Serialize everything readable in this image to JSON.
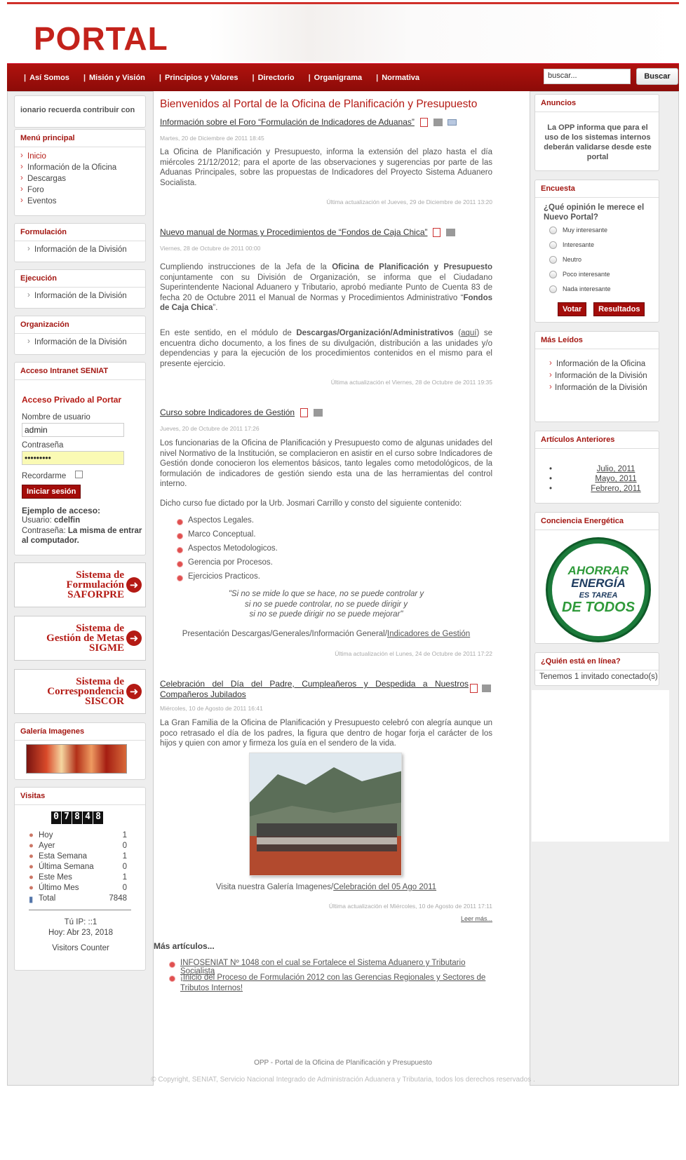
{
  "site": {
    "logo_text": "PORTAL",
    "accent": "#a31611"
  },
  "nav": {
    "items": [
      "Así Somos",
      "Misión y Visión",
      "Principios y Valores",
      "Directorio",
      "Organigrama",
      "Normativa"
    ],
    "search_placeholder": "buscar...",
    "search_button": "Buscar"
  },
  "left": {
    "marquee": "ionario recuerda contribuir con",
    "main_menu": {
      "title": "Menú principal",
      "items": [
        "Inicio",
        "Información de la Oficina",
        "Descargas",
        "Foro",
        "Eventos"
      ]
    },
    "formulacion": {
      "title": "Formulación",
      "item": "Información de la División"
    },
    "ejecucion": {
      "title": "Ejecución",
      "item": "Información de la División"
    },
    "organizacion": {
      "title": "Organización",
      "item": "Información de la División"
    },
    "intranet": {
      "title": "Acceso Intranet SENIAT",
      "heading": "Acceso Privado al Portar",
      "user_label": "Nombre de usuario",
      "user_value": "admin",
      "pass_label": "Contraseña",
      "pass_value": "•••••••••",
      "remember_label": "Recordarme",
      "login_button": "Iniciar sesión",
      "example_title": "Ejemplo de acceso:",
      "example_user_label": "Usuario:",
      "example_user": "cdelfin",
      "example_pass_label": "Contraseña:",
      "example_pass": "La misma de entrar al computador."
    },
    "banners": [
      {
        "l1": "Sistema de",
        "l2": "Formulación",
        "l3": "SAFORPRE"
      },
      {
        "l1": "Sistema de",
        "l2": "Gestión de Metas",
        "l3": "SIGME"
      },
      {
        "l1": "Sistema de",
        "l2": "Correspondencia",
        "l3": "SISCOR"
      }
    ],
    "galeria": {
      "title": "Galería Imagenes"
    },
    "visitas": {
      "title": "Visitas",
      "counter": [
        "0",
        "7",
        "8",
        "4",
        "8"
      ],
      "rows": [
        {
          "label": "Hoy",
          "value": "1"
        },
        {
          "label": "Ayer",
          "value": "0"
        },
        {
          "label": "Esta Semana",
          "value": "1"
        },
        {
          "label": "Última Semana",
          "value": "0"
        },
        {
          "label": "Este Mes",
          "value": "1"
        },
        {
          "label": "Último Mes",
          "value": "0"
        },
        {
          "label": "Total",
          "value": "7848"
        }
      ],
      "ip": "Tú IP: ::1",
      "today": "Hoy: Abr 23, 2018",
      "footer": "Visitors Counter"
    }
  },
  "main": {
    "welcome": "Bienvenidos al Portal de la Oficina de Planificación y Presupuesto",
    "articles": [
      {
        "title": "Información sobre el Foro “Formulación de Indicadores de Aduanas”",
        "date": "Martes, 20 de Diciembre de 2011 18:45",
        "body": "La Oficina de Planificación y Presupuesto, informa la extensión del plazo hasta el día miércoles 21/12/2012; para el aporte de las observaciones y sugerencias por parte de las Aduanas Principales, sobre las propuestas de Indicadores del Proyecto Sistema Aduanero Socialista.",
        "updated": "Última actualización el Jueves, 29 de Diciembre de 2011 13:20"
      },
      {
        "title": "Nuevo manual de Normas y Procedimientos de “Fondos de Caja Chica”",
        "date": "Viernes, 28 de Octubre de 2011 00:00",
        "p1a": "Cumpliendo instrucciones de la Jefa de la ",
        "p1b": "Oficina de Planificación y Presupuesto",
        "p1c": " conjuntamente con su División de Organización, se informa que el Ciudadano Superintendente Nacional Aduanero y Tributario, aprobó mediante Punto de Cuenta 83 de fecha 20 de Octubre 2011 el Manual de Normas y Procedimientos Administrativo “",
        "p1d": "Fondos de Caja Chica",
        "p1e": "”.",
        "p2a": "En este sentido, en el módulo de ",
        "p2b": "Descargas/Organización/Administrativos",
        "p2c": " (",
        "p2link": "aquí",
        "p2d": ") se encuentra dicho documento, a los fines de su divulgación, distribución a las unidades y/o dependencias y para la ejecución de los procedimientos contenidos en el mismo para el presente ejercicio.",
        "updated": "Última actualización el Viernes, 28 de Octubre de 2011 19:35"
      },
      {
        "title": "Curso sobre Indicadores de Gestión",
        "date": "Jueves, 20 de Octubre de 2011 17:26",
        "body": "Los funcionarias de la Oficina de Planificación y Presupuesto como de algunas unidades del nivel Normativo de la Institución, se complacieron en asistir en el curso sobre Indicadores de Gestión donde conocieron los elementos básicos, tanto legales como metodológicos, de la formulación de indicadores de gestión siendo esta una de las herramientas del control interno.",
        "body2": "Dicho curso fue dictado por la Urb. Josmari Carrillo y consto del siguiente  contenido:",
        "list": [
          "Aspectos Legales.",
          "Marco Conceptual.",
          "Aspectos Metodologicos.",
          "Gerencia por Procesos.",
          "Ejercicios Practicos."
        ],
        "quote1": "\"Si no se mide lo que se hace, no se puede controlar y",
        "quote2": "si no se puede controlar, no se puede dirigir y",
        "quote3": "si no se puede dirigir no se puede mejorar\"",
        "pres_prefix": "Presentación Descargas/Generales/Información General/",
        "pres_link": "Indicadores de Gestión",
        "updated": "Última actualización el Lunes, 24 de Octubre de 2011 17:22"
      },
      {
        "title": "Celebración del Día del Padre, Cumpleañeros y Despedida a Nuestros Compañeros Jubilados",
        "date": "Miércoles, 10 de Agosto de 2011 16:41",
        "body": "La Gran Familia de la Oficina de Planificación y Presupuesto celebró con alegría aunque un poco retrasado el día de los padres, la figura que dentro de hogar forja el carácter de los hijos y quien con amor y firmeza los guía en el sendero de la vida.",
        "gal_prefix": "Visita nuestra Galería Imagenes/",
        "gal_link": "Celebración del 05 Ago 2011",
        "updated": "Última actualización el Miércoles, 10 de Agosto de 2011 17:11",
        "readmore": "Leer más..."
      }
    ],
    "more": {
      "title": "Más artículos...",
      "items": [
        "INFOSENIAT Nº 1048 con el cual se Fortalece el Sistema Aduanero y Tributario Socialista",
        "¡Inicio del Proceso de Formulación 2012 con las Gerencias Regionales y Sectores de Tributos Internos!"
      ]
    }
  },
  "right": {
    "anuncios": {
      "title": "Anuncios",
      "text": "La OPP informa que para el uso de los sistemas internos deberán validarse desde este portal"
    },
    "encuesta": {
      "title": "Encuesta",
      "question": "¿Qué opinión le merece el Nuevo Portal?",
      "options": [
        "Muy interesante",
        "Interesante",
        "Neutro",
        "Poco interesante",
        "Nada interesante"
      ],
      "vote": "Votar",
      "results": "Resultados"
    },
    "mas_leidos": {
      "title": "Más Leídos",
      "items": [
        "Información de la Oficina",
        "Información de la División",
        "Información de la División"
      ]
    },
    "anteriores": {
      "title": "Artículos Anteriores",
      "items": [
        "Julio, 2011",
        "Mayo, 2011",
        "Febrero, 2011"
      ]
    },
    "conciencia": {
      "title": "Conciencia Energética",
      "l1": "AHORRAR",
      "l2": "ENERGÍA",
      "l3": "ES TAREA",
      "l4": "DE TODOS"
    },
    "online": {
      "title": "¿Quién está en línea?",
      "text": "Tenemos 1 invitado conectado(s)"
    }
  },
  "footer": {
    "line1": "OPP - Portal de la Oficina de Planificación y Presupuesto",
    "line2": "© Copyright, SENIAT, Servicio Nacional Integrado de Administración Aduanera y Tributaria, todos los derechos reservados ."
  }
}
